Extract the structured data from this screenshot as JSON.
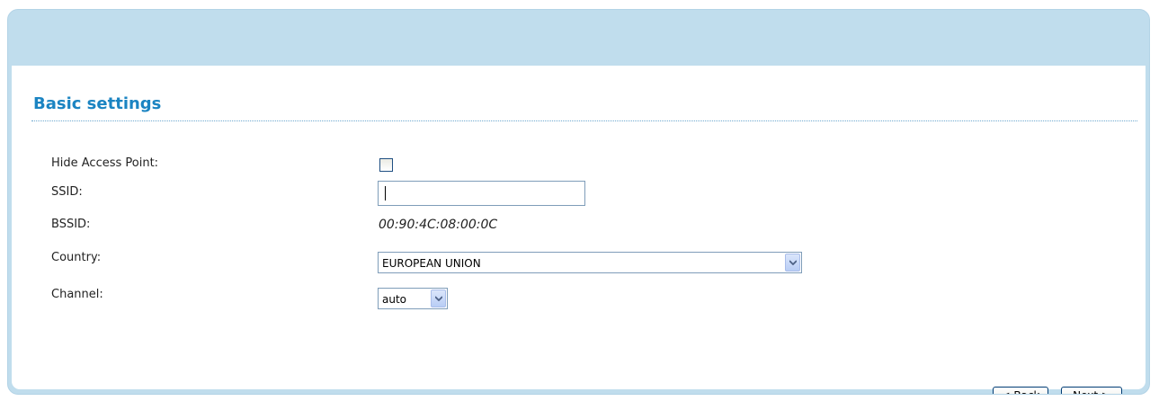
{
  "section": {
    "title": "Basic settings"
  },
  "fields": {
    "hide_ap": {
      "label": "Hide Access Point:",
      "checked": false
    },
    "ssid": {
      "label": "SSID:",
      "value": ""
    },
    "bssid": {
      "label": "BSSID:",
      "value": "00:90:4C:08:00:0C"
    },
    "country": {
      "label": "Country:",
      "value": "EUROPEAN UNION"
    },
    "channel": {
      "label": "Channel:",
      "value": "auto"
    }
  },
  "buttons": {
    "back": "< Back",
    "next": "Next >"
  },
  "icons": {
    "dropdown": "chevron-down-icon"
  },
  "colors": {
    "accent": "#1b84c2",
    "header_band": "#c0dded"
  }
}
